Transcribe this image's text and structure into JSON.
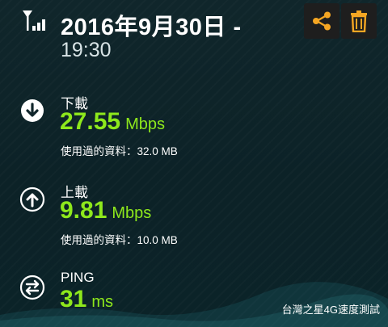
{
  "header": {
    "date": "2016年9月30日 -",
    "time": "19:30",
    "icons": {
      "signal": "signal-strength-icon",
      "share": "share-icon",
      "delete": "trash-icon"
    }
  },
  "download": {
    "label": "下載",
    "value": "27.55",
    "unit": "Mbps",
    "usage": "使用過的資料：32.0 MB",
    "icon": "download-arrow-icon"
  },
  "upload": {
    "label": "上載",
    "value": "9.81",
    "unit": "Mbps",
    "usage": "使用過的資料：10.0 MB",
    "icon": "upload-arrow-icon"
  },
  "ping": {
    "label": "PING",
    "value": "31",
    "unit": "ms",
    "icon": "swap-arrows-icon"
  },
  "footer": {
    "brand": "台灣之星4G速度測試"
  },
  "colors": {
    "accent_green": "#8ee81c",
    "action_orange": "#f5a623",
    "background": "#10262b"
  }
}
